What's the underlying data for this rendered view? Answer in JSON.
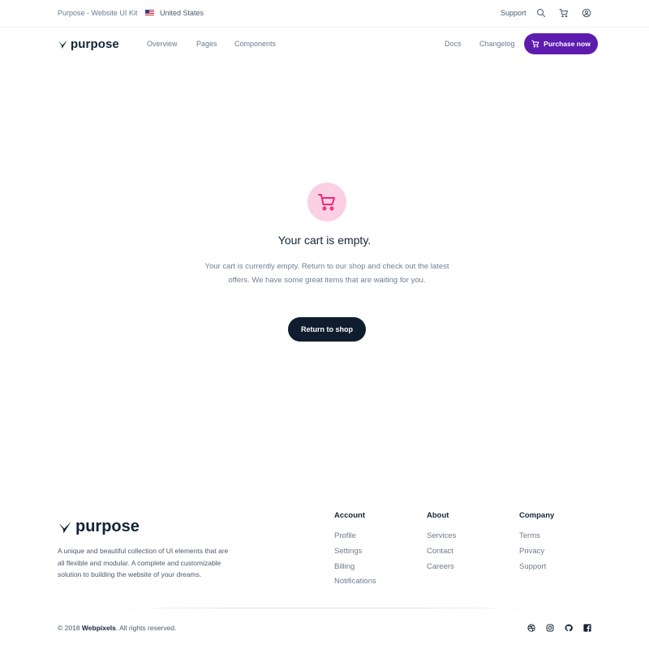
{
  "topbar": {
    "kit_label": "Purpose - Website UI Kit",
    "country": "United States",
    "support": "Support",
    "icons": [
      "us-flag-icon",
      "search-icon",
      "cart-icon",
      "user-icon"
    ]
  },
  "navbar": {
    "brand": "purpose",
    "links": [
      "Overview",
      "Pages",
      "Components"
    ],
    "right_links": [
      "Docs",
      "Changelog"
    ],
    "purchase_label": "Purchase now",
    "accent_color": "#5e1cae"
  },
  "empty_cart": {
    "title": "Your cart is empty.",
    "text": "Your cart is currently empty. Return to our shop and check out the latest offers. We have some great items that are waiting for you.",
    "button": "Return to shop",
    "icon": "cart-icon",
    "icon_color": "#f0287a",
    "icon_bg": "#fbd0e3"
  },
  "footer": {
    "brand": "purpose",
    "description": "A unique and beautiful collection of UI elements that are all flexible and modular. A complete and customizable solution to building the website of your dreams.",
    "columns": [
      {
        "title": "Account",
        "links": [
          "Profile",
          "Settings",
          "Billing",
          "Notifications"
        ]
      },
      {
        "title": "About",
        "links": [
          "Services",
          "Contact",
          "Careers"
        ]
      },
      {
        "title": "Company",
        "links": [
          "Terms",
          "Privacy",
          "Support"
        ]
      }
    ],
    "copyright_prefix": "© 2018",
    "copyright_brand": "Webpixels",
    "copyright_suffix": ". All rights reserved.",
    "social": [
      "dribbble-icon",
      "instagram-icon",
      "github-icon",
      "facebook-icon"
    ]
  }
}
